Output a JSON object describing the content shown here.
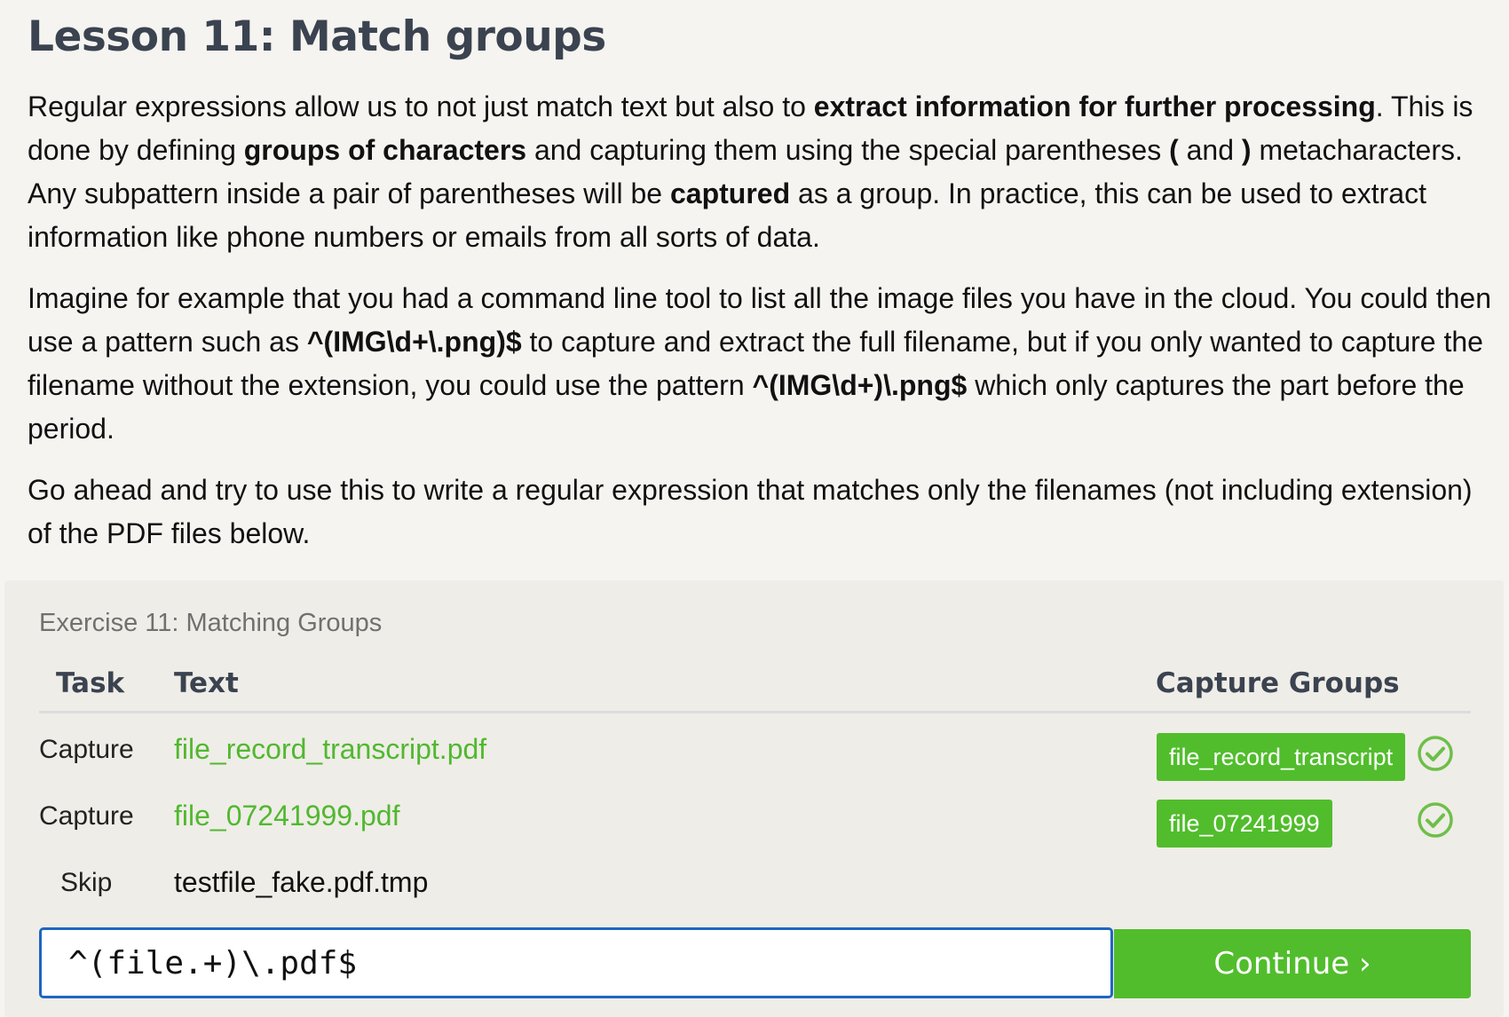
{
  "lesson": {
    "title": "Lesson 11: Match groups",
    "p1": {
      "t1": "Regular expressions allow us to not just match text but also to ",
      "b1": "extract information for further processing",
      "t2": ". This is done by defining ",
      "b2": "groups of characters",
      "t3": " and capturing them using the special parentheses ",
      "b3": "(",
      "t4": " and ",
      "b4": ")",
      "t5": " metacharacters. Any subpattern inside a pair of parentheses will be ",
      "b5": "captured",
      "t6": " as a group. In practice, this can be used to extract information like phone numbers or emails from all sorts of data."
    },
    "p2": {
      "t1": "Imagine for example that you had a command line tool to list all the image files you have in the cloud. You could then use a pattern such as ",
      "b1": "^(IMG\\d+\\.png)$",
      "t2": " to capture and extract the full filename, but if you only wanted to capture the filename without the extension, you could use the pattern ",
      "b2": "^(IMG\\d+)\\.png$",
      "t3": " which only captures the part before the period."
    },
    "p3": {
      "t1": "Go ahead and try to use this to write a regular expression that matches only the filenames (not including extension) of the PDF files below."
    }
  },
  "exercise": {
    "title": "Exercise 11: Matching Groups",
    "columns": {
      "task": "Task",
      "text": "Text",
      "groups": "Capture Groups"
    },
    "rows": [
      {
        "task": "Capture",
        "text": "file_record_transcript.pdf",
        "group": "file_record_transcript",
        "status_icon": "check-circle-icon"
      },
      {
        "task": "Capture",
        "text": "file_07241999.pdf",
        "group": "file_07241999",
        "status_icon": "check-circle-icon"
      },
      {
        "task": "Skip",
        "text": "testfile_fake.pdf.tmp"
      }
    ],
    "input_value": "^(file.+)\\.pdf$",
    "continue_label": "Continue ›"
  },
  "colors": {
    "accent_green": "#51bd2c",
    "match_text_green": "#51b830",
    "input_border_blue": "#1f66c2",
    "heading": "#3b4350"
  }
}
